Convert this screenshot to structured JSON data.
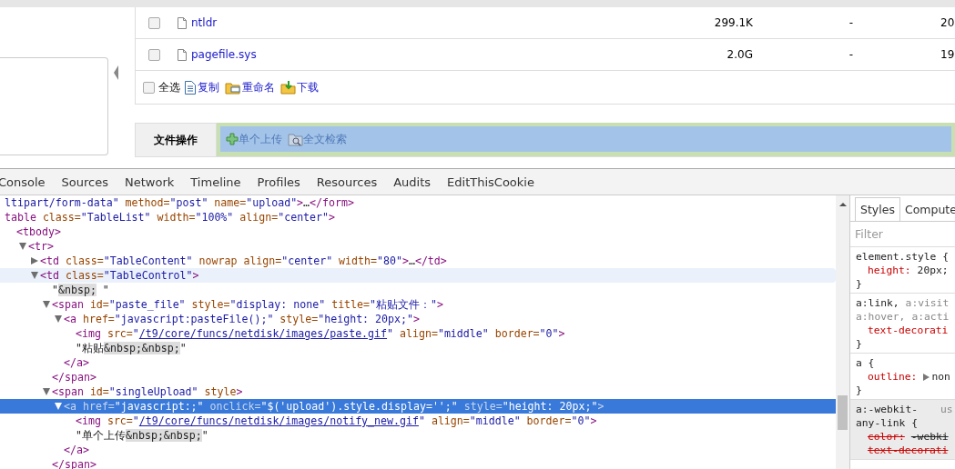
{
  "files": [
    {
      "name": "ntldr",
      "size": "299.1K",
      "column_4": "-",
      "column_5": "20",
      "checked": false
    },
    {
      "name": "pagefile.sys",
      "size": "2.0G",
      "column_4": "-",
      "column_5": "19",
      "checked": false
    }
  ],
  "file_toolbar": {
    "select_all": {
      "label": "全选",
      "checked": false
    },
    "actions": [
      {
        "kind": "copy",
        "label": "复制"
      },
      {
        "kind": "rename",
        "label": "重命名"
      },
      {
        "kind": "download",
        "label": "下载"
      }
    ]
  },
  "file_operations": {
    "label": "文件操作",
    "actions": [
      {
        "kind": "upload",
        "label": "单个上传"
      },
      {
        "kind": "search",
        "label": "全文检索"
      }
    ]
  },
  "devtools": {
    "tabs": [
      "Console",
      "Sources",
      "Network",
      "Timeline",
      "Profiles",
      "Resources",
      "Audits",
      "EditThisCookie"
    ],
    "dom": [
      {
        "selected": false,
        "hovered": false,
        "tokens": [
          {
            "kind": "val",
            "text": "ltipart/form-data\""
          },
          {
            "kind": "attr",
            "text": " method="
          },
          {
            "kind": "val",
            "text": "\"post\""
          },
          {
            "kind": "attr",
            "text": " name="
          },
          {
            "kind": "val",
            "text": "\"upload\""
          },
          {
            "kind": "tag",
            "text": ">"
          },
          {
            "kind": "text",
            "text": "…"
          },
          {
            "kind": "tag",
            "text": "</form>"
          }
        ]
      },
      {
        "selected": false,
        "hovered": false,
        "tokens": [
          {
            "kind": "tag",
            "text": "table"
          },
          {
            "kind": "attr",
            "text": " class="
          },
          {
            "kind": "val",
            "text": "\"TableList\""
          },
          {
            "kind": "attr",
            "text": " width="
          },
          {
            "kind": "val",
            "text": "\"100%\""
          },
          {
            "kind": "attr",
            "text": " align="
          },
          {
            "kind": "val",
            "text": "\"center\""
          },
          {
            "kind": "tag",
            "text": ">"
          }
        ],
        "children": [
          {
            "selected": false,
            "hovered": false,
            "tokens": [
              {
                "kind": "tag",
                "text": "<tbody>"
              }
            ],
            "children": [
              {
                "selected": false,
                "hovered": false,
                "expanded": true,
                "tokens": [
                  {
                    "kind": "tag",
                    "text": "<tr>"
                  }
                ],
                "children": [
                  {
                    "selected": false,
                    "hovered": false,
                    "expanded": false,
                    "tokens": [
                      {
                        "kind": "tag",
                        "text": "<td"
                      },
                      {
                        "kind": "attr",
                        "text": " class="
                      },
                      {
                        "kind": "val",
                        "text": "\"TableContent\""
                      },
                      {
                        "kind": "attr",
                        "text": " nowrap align="
                      },
                      {
                        "kind": "val",
                        "text": "\"center\""
                      },
                      {
                        "kind": "attr",
                        "text": " width="
                      },
                      {
                        "kind": "val",
                        "text": "\"80\""
                      },
                      {
                        "kind": "tag",
                        "text": ">"
                      },
                      {
                        "kind": "text",
                        "text": "…"
                      },
                      {
                        "kind": "tag",
                        "text": "</td>"
                      }
                    ]
                  },
                  {
                    "selected": false,
                    "hovered": true,
                    "expanded": true,
                    "tokens": [
                      {
                        "kind": "tag",
                        "text": "<td"
                      },
                      {
                        "kind": "attr",
                        "text": " class="
                      },
                      {
                        "kind": "val",
                        "text": "\"TableControl\""
                      },
                      {
                        "kind": "tag",
                        "text": ">"
                      }
                    ],
                    "children": [
                      {
                        "selected": false,
                        "hovered": false,
                        "tokens": [
                          {
                            "kind": "text",
                            "text": "\""
                          },
                          {
                            "kind": "entity",
                            "text": "&nbsp;"
                          },
                          {
                            "kind": "text",
                            "text": " \""
                          }
                        ]
                      },
                      {
                        "selected": false,
                        "hovered": false,
                        "expanded": true,
                        "tokens": [
                          {
                            "kind": "tag",
                            "text": "<span"
                          },
                          {
                            "kind": "attr",
                            "text": " id="
                          },
                          {
                            "kind": "val",
                            "text": "\"paste_file\""
                          },
                          {
                            "kind": "attr",
                            "text": " style="
                          },
                          {
                            "kind": "val",
                            "text": "\"display: none\""
                          },
                          {
                            "kind": "attr",
                            "text": " title="
                          },
                          {
                            "kind": "val",
                            "text": "\"粘贴文件：\""
                          },
                          {
                            "kind": "tag",
                            "text": ">"
                          }
                        ],
                        "close": "</span>",
                        "children": [
                          {
                            "selected": false,
                            "hovered": false,
                            "expanded": true,
                            "tokens": [
                              {
                                "kind": "tag",
                                "text": "<a"
                              },
                              {
                                "kind": "attr",
                                "text": " href="
                              },
                              {
                                "kind": "val",
                                "text": "\"javascript:pasteFile();\""
                              },
                              {
                                "kind": "attr",
                                "text": " style="
                              },
                              {
                                "kind": "val",
                                "text": "\"height: 20px;\""
                              },
                              {
                                "kind": "tag",
                                "text": ">"
                              }
                            ],
                            "close": "</a>",
                            "children": [
                              {
                                "selected": false,
                                "hovered": false,
                                "tokens": [
                                  {
                                    "kind": "tag",
                                    "text": "<img"
                                  },
                                  {
                                    "kind": "attr",
                                    "text": " src="
                                  },
                                  {
                                    "kind": "val",
                                    "text": "\""
                                  },
                                  {
                                    "kind": "link",
                                    "text": "/t9/core/funcs/netdisk/images/paste.gif"
                                  },
                                  {
                                    "kind": "val",
                                    "text": "\""
                                  },
                                  {
                                    "kind": "attr",
                                    "text": " align="
                                  },
                                  {
                                    "kind": "val",
                                    "text": "\"middle\""
                                  },
                                  {
                                    "kind": "attr",
                                    "text": " border="
                                  },
                                  {
                                    "kind": "val",
                                    "text": "\"0\""
                                  },
                                  {
                                    "kind": "tag",
                                    "text": ">"
                                  }
                                ]
                              },
                              {
                                "selected": false,
                                "hovered": false,
                                "tokens": [
                                  {
                                    "kind": "text",
                                    "text": "\"粘贴"
                                  },
                                  {
                                    "kind": "entity",
                                    "text": "&nbsp;&nbsp;"
                                  },
                                  {
                                    "kind": "text",
                                    "text": "\""
                                  }
                                ]
                              }
                            ]
                          }
                        ]
                      },
                      {
                        "selected": false,
                        "hovered": false,
                        "expanded": true,
                        "tokens": [
                          {
                            "kind": "tag",
                            "text": "<span"
                          },
                          {
                            "kind": "attr",
                            "text": " id="
                          },
                          {
                            "kind": "val",
                            "text": "\"singleUpload\""
                          },
                          {
                            "kind": "attr",
                            "text": " style"
                          },
                          {
                            "kind": "tag",
                            "text": ">"
                          }
                        ],
                        "close": "</span>",
                        "children": [
                          {
                            "selected": true,
                            "hovered": false,
                            "expanded": true,
                            "tokens": [
                              {
                                "kind": "tag",
                                "text": "<a"
                              },
                              {
                                "kind": "attr",
                                "text": " href="
                              },
                              {
                                "kind": "val",
                                "text": "\"javascript:;\""
                              },
                              {
                                "kind": "attr",
                                "text": " onclick="
                              },
                              {
                                "kind": "val",
                                "text": "\"$('upload').style.display='';\""
                              },
                              {
                                "kind": "attr",
                                "text": " style="
                              },
                              {
                                "kind": "val",
                                "text": "\"height: 20px;\""
                              },
                              {
                                "kind": "tag",
                                "text": ">"
                              }
                            ],
                            "close": "</a>",
                            "children": [
                              {
                                "selected": false,
                                "hovered": false,
                                "tokens": [
                                  {
                                    "kind": "tag",
                                    "text": "<img"
                                  },
                                  {
                                    "kind": "attr",
                                    "text": " src="
                                  },
                                  {
                                    "kind": "val",
                                    "text": "\""
                                  },
                                  {
                                    "kind": "link",
                                    "text": "/t9/core/funcs/netdisk/images/notify_new.gif"
                                  },
                                  {
                                    "kind": "val",
                                    "text": "\""
                                  },
                                  {
                                    "kind": "attr",
                                    "text": " align="
                                  },
                                  {
                                    "kind": "val",
                                    "text": "\"middle\""
                                  },
                                  {
                                    "kind": "attr",
                                    "text": " border="
                                  },
                                  {
                                    "kind": "val",
                                    "text": "\"0\""
                                  },
                                  {
                                    "kind": "tag",
                                    "text": ">"
                                  }
                                ]
                              },
                              {
                                "selected": false,
                                "hovered": false,
                                "tokens": [
                                  {
                                    "kind": "text",
                                    "text": "\"单个上传"
                                  },
                                  {
                                    "kind": "entity",
                                    "text": "&nbsp;&nbsp;"
                                  },
                                  {
                                    "kind": "text",
                                    "text": "\""
                                  }
                                ]
                              }
                            ]
                          }
                        ]
                      }
                    ]
                  }
                ]
              }
            ]
          }
        ]
      }
    ],
    "styles_tabs": [
      {
        "label": "Styles",
        "selected": true
      },
      {
        "label": "Compute",
        "selected": false
      }
    ],
    "filter": {
      "placeholder": "Filter"
    },
    "rules": [
      {
        "user_agent": false,
        "selector_lines": [
          [
            {
              "text": "element.style {",
              "matched": true
            }
          ]
        ],
        "properties": [
          {
            "name": "height:",
            "value": "20px;",
            "overridden": false
          }
        ],
        "close": "}"
      },
      {
        "user_agent": false,
        "selector_lines": [
          [
            {
              "text": "a:link,",
              "matched": true
            },
            {
              "text": "a:visit",
              "matched": false
            }
          ],
          [
            {
              "text": "a:hover,",
              "matched": false
            },
            {
              "text": "a:acti",
              "matched": false
            }
          ]
        ],
        "properties": [
          {
            "name": "text-decorati",
            "overridden": false
          }
        ],
        "close": "}"
      },
      {
        "user_agent": false,
        "selector_lines": [
          [
            {
              "text": "a {",
              "matched": true
            }
          ]
        ],
        "properties": [
          {
            "name": "outline:",
            "value": "non",
            "expandable": true,
            "overridden": false
          }
        ],
        "close": "}"
      },
      {
        "user_agent": true,
        "origin": "us",
        "selector_lines": [
          [
            {
              "text": "a:-webkit-",
              "matched": true
            }
          ],
          [
            {
              "text": "any-link {",
              "matched": true
            }
          ]
        ],
        "properties": [
          {
            "name": "color:",
            "value": "-webki",
            "overridden": true
          },
          {
            "name": "text-decorati",
            "overridden": true
          }
        ]
      }
    ]
  }
}
